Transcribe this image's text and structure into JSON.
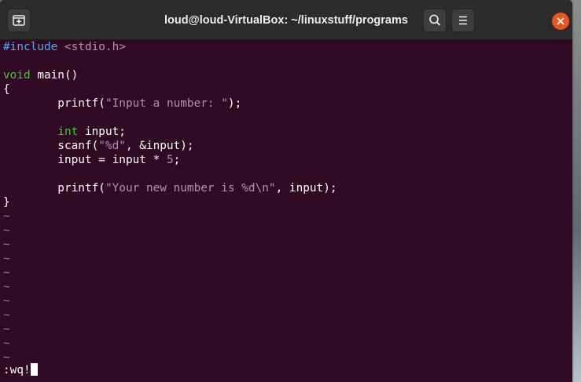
{
  "window": {
    "title": "loud@loud-VirtualBox: ~/linuxstuff/programs"
  },
  "code": {
    "l1_directive": "#include",
    "l1_header": " <stdio.h>",
    "l3_type": "void",
    "l3_rest": " main()",
    "l4": "{",
    "l5_fn": "        printf(",
    "l5_str": "\"Input a number: \"",
    "l5_end": ");",
    "l7_type": "int",
    "l7_rest": " input;",
    "l8_fn": "        scanf(",
    "l8_str": "\"%d\"",
    "l8_end": ", &input);",
    "l9_pre": "        input = input * ",
    "l9_num": "5",
    "l9_end": ";",
    "l11_fn": "        printf(",
    "l11_str": "\"Your new number is %d\\n\"",
    "l11_end": ", input);",
    "l12": "}",
    "tilde": "~"
  },
  "command_line": ":wq!",
  "icons": [
    "new-tab-icon",
    "search-icon",
    "hamburger-menu-icon",
    "close-icon"
  ],
  "colors": {
    "terminal_bg": "#300a24",
    "close": "#e95420",
    "preprocessor": "#53a6e8",
    "type": "#43c92a",
    "string": "#b58fb0"
  }
}
